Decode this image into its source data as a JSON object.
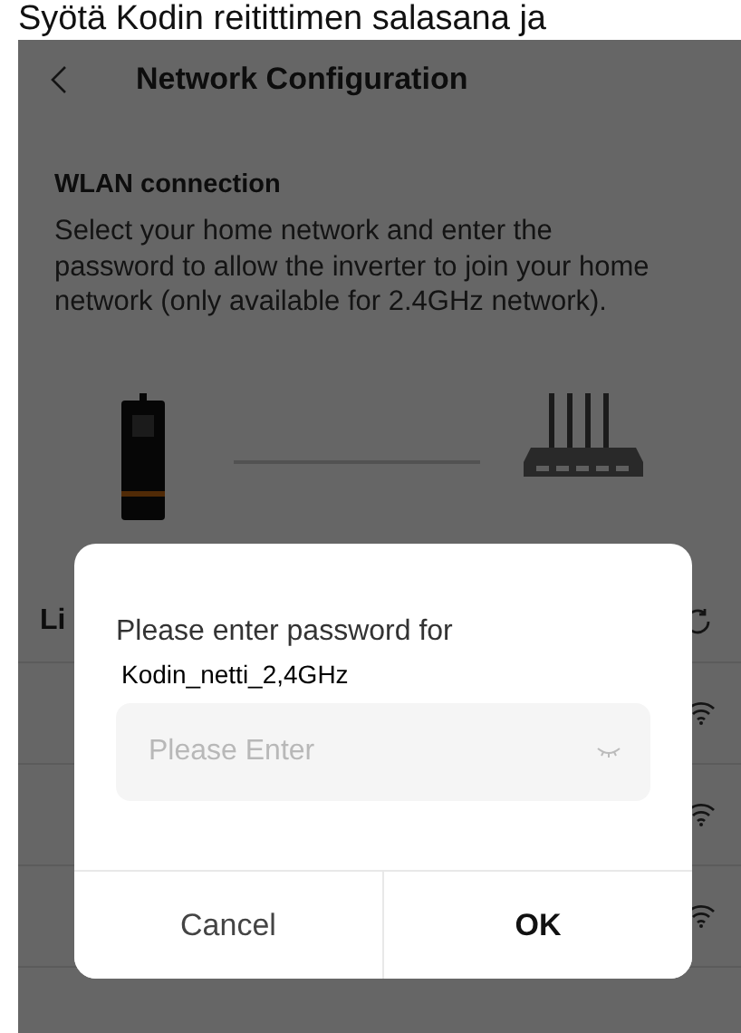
{
  "caption": "Syötä Kodin reitittimen salasana ja",
  "header": {
    "title": "Network Configuration"
  },
  "section": {
    "heading": "WLAN connection",
    "description": "Select your home network and enter the password to allow the inverter to join your home network (only available for 2.4GHz network)."
  },
  "list": {
    "heading": "Li"
  },
  "dialog": {
    "prompt": "Please enter password for",
    "network": "Kodin_netti_2,4GHz",
    "input": {
      "placeholder": "Please Enter"
    },
    "buttons": [
      {
        "label": "Cancel",
        "kind": "cancel"
      },
      {
        "label": "OK",
        "kind": "confirm"
      }
    ]
  }
}
